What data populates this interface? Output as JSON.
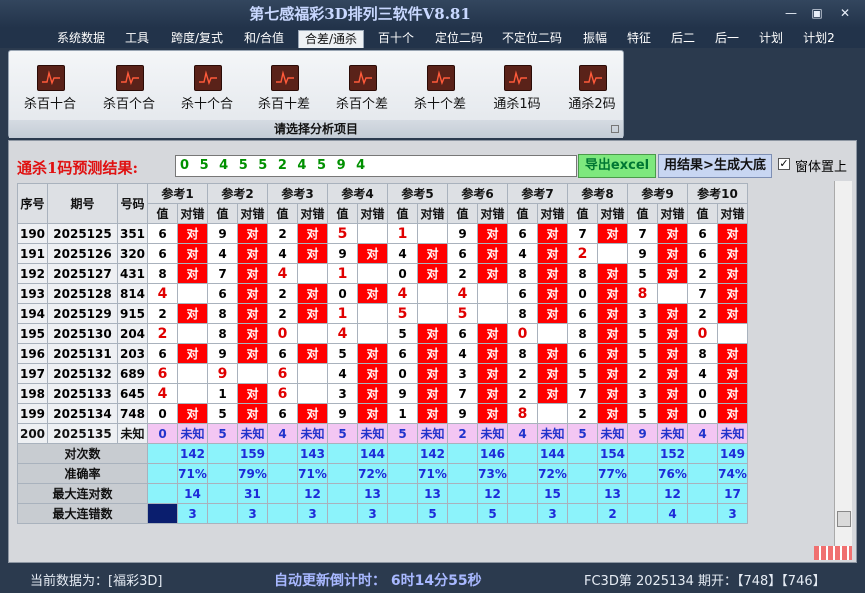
{
  "window": {
    "title": "第七感福彩3D排列三软件V8.81",
    "controls": [
      "—",
      "▣",
      "✕"
    ]
  },
  "menu": [
    {
      "label": "系统数据"
    },
    {
      "label": "工具"
    },
    {
      "label": "跨度/复式"
    },
    {
      "label": "和/合值"
    },
    {
      "label": "合差/通杀",
      "active": true
    },
    {
      "label": "百十个"
    },
    {
      "label": "定位二码"
    },
    {
      "label": "不定位二码"
    },
    {
      "label": "振幅"
    },
    {
      "label": "特征"
    },
    {
      "label": "后二"
    },
    {
      "label": "后一"
    },
    {
      "label": "计划"
    },
    {
      "label": "计划2"
    }
  ],
  "ribbon": {
    "buttons": [
      {
        "label": "杀百十合"
      },
      {
        "label": "杀百个合"
      },
      {
        "label": "杀十个合"
      },
      {
        "label": "杀百十差"
      },
      {
        "label": "杀百个差"
      },
      {
        "label": "杀十个差"
      },
      {
        "label": "通杀1码"
      },
      {
        "label": "通杀2码"
      }
    ],
    "footer": "请选择分析项目"
  },
  "prediction": {
    "label": "通杀1码预测结果:",
    "value": "0 5 4 5 5 2 4 5 9 4",
    "excel_button": "导出excel",
    "generate_button": "用结果>生成大底",
    "topmost_label": "窗体置上",
    "topmost_checked": true
  },
  "table": {
    "col_headers": [
      "序号",
      "期号",
      "号码"
    ],
    "ref_headers": [
      "参考1",
      "参考2",
      "参考3",
      "参考4",
      "参考5",
      "参考6",
      "参考7",
      "参考8",
      "参考9",
      "参考10"
    ],
    "sub_headers": [
      "值",
      "对错"
    ],
    "ok_text": "对",
    "rows": [
      {
        "idx": "190",
        "period": "2025125",
        "num": "351",
        "cells": [
          [
            "6",
            1
          ],
          [
            "9",
            1
          ],
          [
            "2",
            1
          ],
          [
            "5",
            0
          ],
          [
            "1",
            0
          ],
          [
            "9",
            1
          ],
          [
            "6",
            1
          ],
          [
            "7",
            1
          ],
          [
            "7",
            1
          ],
          [
            "6",
            1
          ]
        ]
      },
      {
        "idx": "191",
        "period": "2025126",
        "num": "320",
        "cells": [
          [
            "6",
            1
          ],
          [
            "4",
            1
          ],
          [
            "4",
            1
          ],
          [
            "9",
            1
          ],
          [
            "4",
            1
          ],
          [
            "6",
            1
          ],
          [
            "4",
            1
          ],
          [
            "2",
            0
          ],
          [
            "9",
            1
          ],
          [
            "6",
            1
          ]
        ]
      },
      {
        "idx": "192",
        "period": "2025127",
        "num": "431",
        "cells": [
          [
            "8",
            1
          ],
          [
            "7",
            1
          ],
          [
            "4",
            0
          ],
          [
            "1",
            0
          ],
          [
            "0",
            1
          ],
          [
            "2",
            1
          ],
          [
            "8",
            1
          ],
          [
            "8",
            1
          ],
          [
            "5",
            1
          ],
          [
            "2",
            1
          ]
        ]
      },
      {
        "idx": "193",
        "period": "2025128",
        "num": "814",
        "cells": [
          [
            "4",
            0
          ],
          [
            "6",
            1
          ],
          [
            "2",
            1
          ],
          [
            "0",
            1
          ],
          [
            "4",
            0
          ],
          [
            "4",
            0
          ],
          [
            "6",
            1
          ],
          [
            "0",
            1
          ],
          [
            "8",
            0
          ],
          [
            "7",
            1
          ]
        ]
      },
      {
        "idx": "194",
        "period": "2025129",
        "num": "915",
        "cells": [
          [
            "2",
            1
          ],
          [
            "8",
            1
          ],
          [
            "2",
            1
          ],
          [
            "1",
            0
          ],
          [
            "5",
            0
          ],
          [
            "5",
            0
          ],
          [
            "8",
            1
          ],
          [
            "6",
            1
          ],
          [
            "3",
            1
          ],
          [
            "2",
            1
          ]
        ]
      },
      {
        "idx": "195",
        "period": "2025130",
        "num": "204",
        "cells": [
          [
            "2",
            0
          ],
          [
            "8",
            1
          ],
          [
            "0",
            0
          ],
          [
            "4",
            0
          ],
          [
            "5",
            1
          ],
          [
            "6",
            1
          ],
          [
            "0",
            0
          ],
          [
            "8",
            1
          ],
          [
            "5",
            1
          ],
          [
            "0",
            0
          ]
        ]
      },
      {
        "idx": "196",
        "period": "2025131",
        "num": "203",
        "cells": [
          [
            "6",
            1
          ],
          [
            "9",
            1
          ],
          [
            "6",
            1
          ],
          [
            "5",
            1
          ],
          [
            "6",
            1
          ],
          [
            "4",
            1
          ],
          [
            "8",
            1
          ],
          [
            "6",
            1
          ],
          [
            "5",
            1
          ],
          [
            "8",
            1
          ]
        ]
      },
      {
        "idx": "197",
        "period": "2025132",
        "num": "689",
        "cells": [
          [
            "6",
            0
          ],
          [
            "9",
            0
          ],
          [
            "6",
            0
          ],
          [
            "4",
            1
          ],
          [
            "0",
            1
          ],
          [
            "3",
            1
          ],
          [
            "2",
            1
          ],
          [
            "5",
            1
          ],
          [
            "2",
            1
          ],
          [
            "4",
            1
          ]
        ]
      },
      {
        "idx": "198",
        "period": "2025133",
        "num": "645",
        "cells": [
          [
            "4",
            0
          ],
          [
            "1",
            1
          ],
          [
            "6",
            0
          ],
          [
            "3",
            1
          ],
          [
            "9",
            1
          ],
          [
            "7",
            1
          ],
          [
            "2",
            1
          ],
          [
            "7",
            1
          ],
          [
            "3",
            1
          ],
          [
            "0",
            1
          ]
        ]
      },
      {
        "idx": "199",
        "period": "2025134",
        "num": "748",
        "cells": [
          [
            "0",
            1
          ],
          [
            "5",
            1
          ],
          [
            "6",
            1
          ],
          [
            "9",
            1
          ],
          [
            "1",
            1
          ],
          [
            "9",
            1
          ],
          [
            "8",
            0
          ],
          [
            "2",
            1
          ],
          [
            "5",
            1
          ],
          [
            "0",
            1
          ]
        ]
      }
    ],
    "future_row": {
      "idx": "200",
      "period": "2025135",
      "num": "未知",
      "values": [
        "0",
        "5",
        "4",
        "5",
        "5",
        "2",
        "4",
        "5",
        "9",
        "4"
      ],
      "status": "未知"
    },
    "stats": [
      {
        "label": "对次数",
        "values": [
          "142",
          "159",
          "143",
          "144",
          "142",
          "146",
          "144",
          "154",
          "152",
          "149"
        ]
      },
      {
        "label": "准确率",
        "values": [
          "71%",
          "79%",
          "71%",
          "72%",
          "71%",
          "73%",
          "72%",
          "77%",
          "76%",
          "74%"
        ]
      },
      {
        "label": "最大连对数",
        "values": [
          "14",
          "31",
          "12",
          "13",
          "13",
          "12",
          "15",
          "13",
          "12",
          "17"
        ]
      },
      {
        "label": "最大连错数",
        "values": [
          "3",
          "3",
          "3",
          "3",
          "5",
          "5",
          "3",
          "2",
          "4",
          "3"
        ]
      }
    ]
  },
  "status": {
    "current_data": "当前数据为：[福彩3D]",
    "countdown": "自动更新倒计时：   6时14分55秒",
    "draw_info": "FC3D第 2025134 期开：【748】【746】"
  }
}
